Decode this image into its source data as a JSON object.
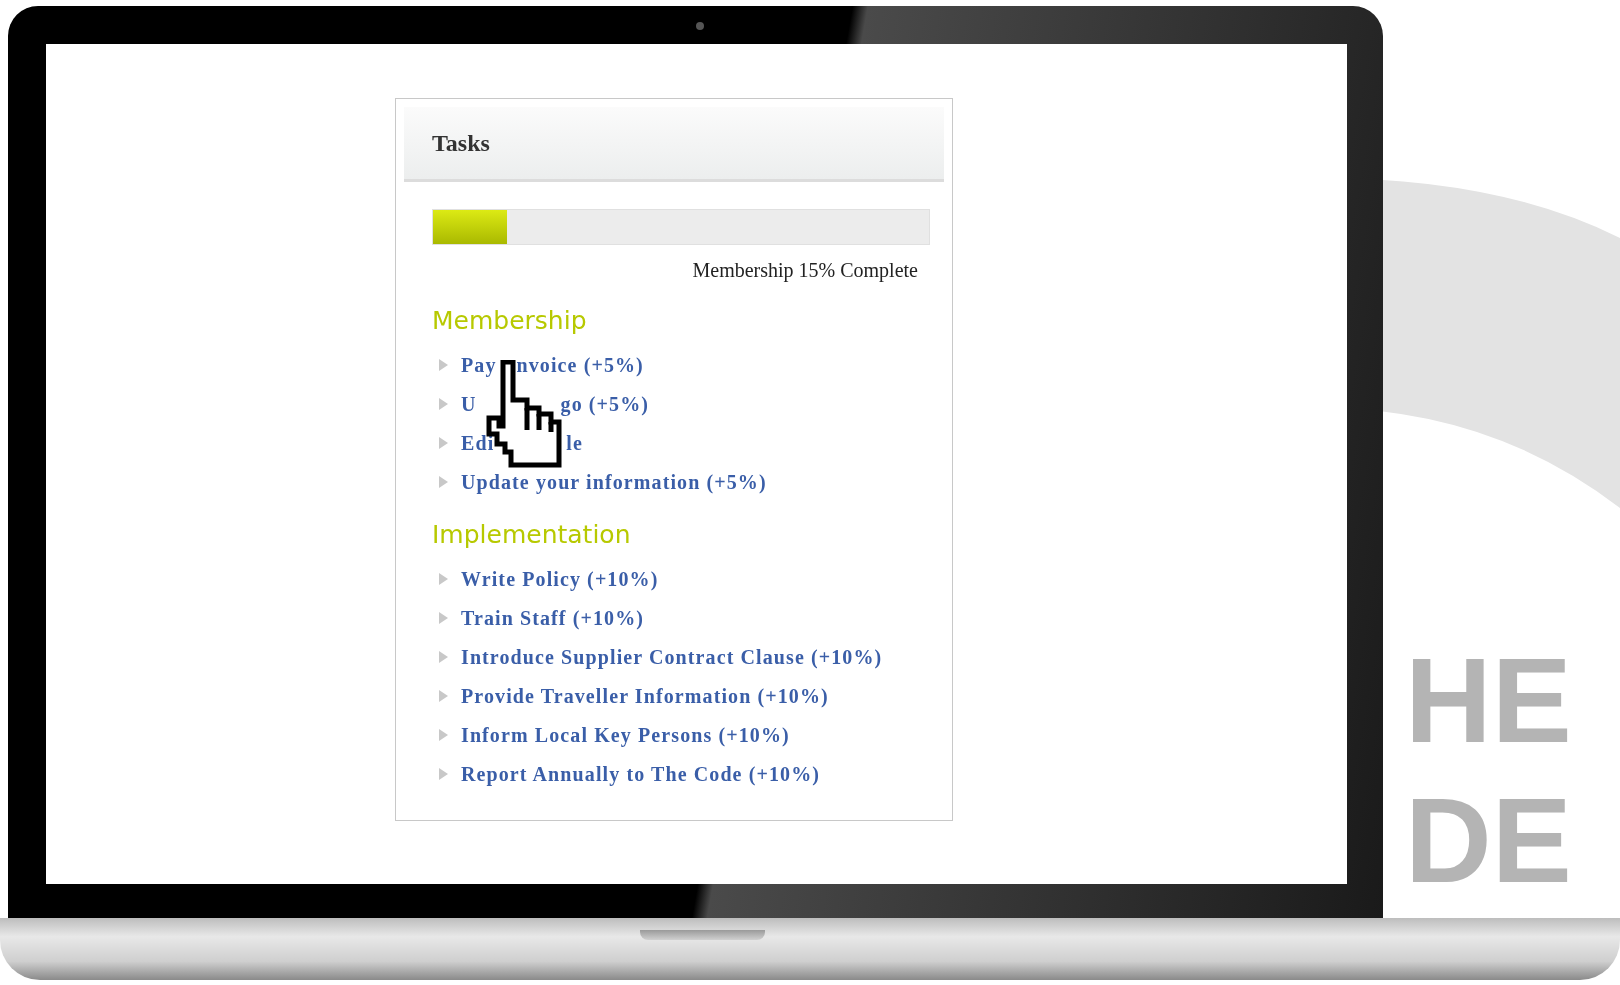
{
  "card": {
    "title": "Tasks",
    "progress": {
      "level": 0.15,
      "caption": "Membership 15% Complete"
    },
    "sections": [
      {
        "heading": "Membership",
        "items": [
          {
            "segments": [
              "Pay",
              "nvoice (+5%)"
            ]
          },
          {
            "segments": [
              "U",
              "go (+5%)"
            ]
          },
          {
            "segments": [
              "Edi",
              "le"
            ]
          },
          {
            "segments": [
              "Update your information (+5%)"
            ]
          }
        ]
      },
      {
        "heading": "Implementation",
        "items": [
          {
            "segments": [
              "Write Policy (+10%)"
            ]
          },
          {
            "segments": [
              "Train Staff (+10%)"
            ]
          },
          {
            "segments": [
              "Introduce Supplier Contract Clause (+10%)"
            ]
          },
          {
            "segments": [
              "Provide Traveller Information (+10%)"
            ]
          },
          {
            "segments": [
              "Inform Local Key Persons (+10%)"
            ]
          },
          {
            "segments": [
              "Report Annually to The Code (+10%)"
            ]
          }
        ]
      }
    ]
  },
  "background_logo": {
    "lines": [
      "HE",
      "DE"
    ]
  }
}
